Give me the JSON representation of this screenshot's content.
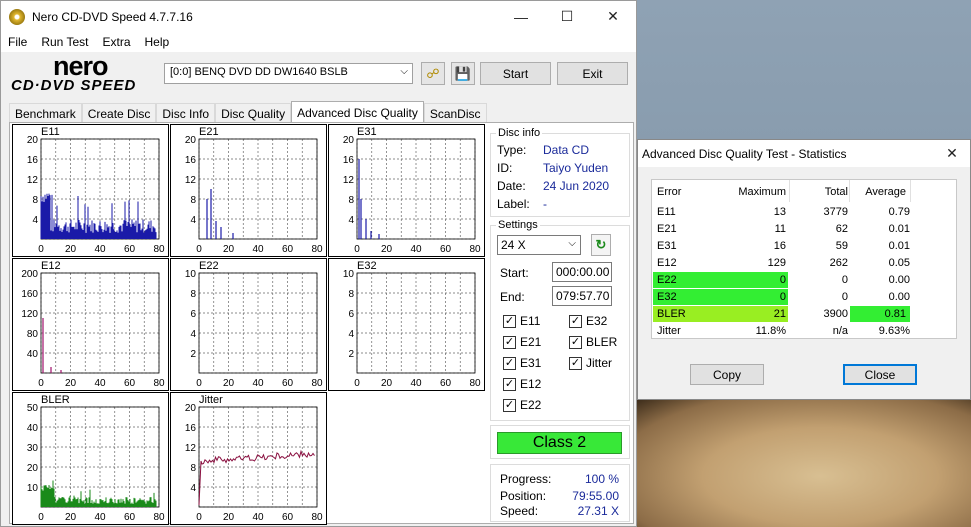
{
  "app": {
    "title": "Nero CD-DVD Speed 4.7.7.16",
    "menu": [
      "File",
      "Run Test",
      "Extra",
      "Help"
    ],
    "logo_word": "nero",
    "logo_sub": "CD·DVD SPEED",
    "drive": "[0:0]   BENQ DVD DD DW1640 BSLB",
    "start_label": "Start",
    "exit_label": "Exit",
    "tabs": [
      "Benchmark",
      "Create Disc",
      "Disc Info",
      "Disc Quality",
      "Advanced Disc Quality",
      "ScanDisc"
    ],
    "active_tab": "Advanced Disc Quality"
  },
  "disc_info": {
    "label": "Disc info",
    "type_key": "Type:",
    "type": "Data CD",
    "id_key": "ID:",
    "id": "Taiyo Yuden",
    "date_key": "Date:",
    "date": "24 Jun 2020",
    "label_key": "Label:",
    "label_val": "-"
  },
  "settings": {
    "label": "Settings",
    "speed": "24 X",
    "start_key": "Start:",
    "start": "000:00.00",
    "end_key": "End:",
    "end": "079:57.70",
    "checkboxes": [
      {
        "label": "E11",
        "checked": true
      },
      {
        "label": "E32",
        "checked": true
      },
      {
        "label": "E21",
        "checked": true
      },
      {
        "label": "BLER",
        "checked": true
      },
      {
        "label": "E31",
        "checked": true
      },
      {
        "label": "Jitter",
        "checked": true
      },
      {
        "label": "E12",
        "checked": true
      },
      {
        "label": "E22",
        "checked": true
      }
    ]
  },
  "class_label": "Class 2",
  "progress": {
    "progress_key": "Progress:",
    "progress": "100 %",
    "position_key": "Position:",
    "position": "79:55.00",
    "speed_key": "Speed:",
    "speed": "27.31 X"
  },
  "graphs": [
    {
      "name": "E11",
      "yticks": [
        "20",
        "16",
        "12",
        "8",
        "4"
      ],
      "xticks": [
        "0",
        "20",
        "40",
        "60",
        "80"
      ],
      "color": "#1a1aa8"
    },
    {
      "name": "E21",
      "yticks": [
        "20",
        "16",
        "12",
        "8",
        "4"
      ],
      "xticks": [
        "0",
        "20",
        "40",
        "60",
        "80"
      ],
      "color": "#1a1aa8"
    },
    {
      "name": "E31",
      "yticks": [
        "20",
        "16",
        "12",
        "8",
        "4"
      ],
      "xticks": [
        "0",
        "20",
        "40",
        "60",
        "80"
      ],
      "color": "#1a1aa8"
    },
    {
      "name": "E12",
      "yticks": [
        "200",
        "160",
        "120",
        "80",
        "40"
      ],
      "xticks": [
        "0",
        "20",
        "40",
        "60",
        "80"
      ],
      "color": "#a0106a"
    },
    {
      "name": "E22",
      "yticks": [
        "10",
        "8",
        "6",
        "4",
        "2"
      ],
      "xticks": [
        "0",
        "20",
        "40",
        "60",
        "80"
      ],
      "color": "#1a1aa8"
    },
    {
      "name": "E32",
      "yticks": [
        "10",
        "8",
        "6",
        "4",
        "2"
      ],
      "xticks": [
        "0",
        "20",
        "40",
        "60",
        "80"
      ],
      "color": "#1a1aa8"
    },
    {
      "name": "BLER",
      "yticks": [
        "50",
        "40",
        "30",
        "20",
        "10"
      ],
      "xticks": [
        "0",
        "20",
        "40",
        "60",
        "80"
      ],
      "color": "#1a8a1a"
    },
    {
      "name": "Jitter",
      "yticks": [
        "20",
        "16",
        "12",
        "8",
        "4"
      ],
      "xticks": [
        "0",
        "20",
        "40",
        "60",
        "80"
      ],
      "color": "#8a1040"
    }
  ],
  "stats": {
    "title": "Advanced Disc Quality Test - Statistics",
    "headers": [
      "Error",
      "Maximum",
      "Total",
      "Average"
    ],
    "rows": [
      {
        "error": "E11",
        "maximum": "13",
        "total": "3779",
        "average": "0.79",
        "hl_max": "",
        "hl_avg": ""
      },
      {
        "error": "E21",
        "maximum": "11",
        "total": "62",
        "average": "0.01",
        "hl_max": "",
        "hl_avg": ""
      },
      {
        "error": "E31",
        "maximum": "16",
        "total": "59",
        "average": "0.01",
        "hl_max": "",
        "hl_avg": ""
      },
      {
        "error": "E12",
        "maximum": "129",
        "total": "262",
        "average": "0.05",
        "hl_max": "",
        "hl_avg": ""
      },
      {
        "error": "E22",
        "maximum": "0",
        "total": "0",
        "average": "0.00",
        "hl_max": "#33ee33",
        "hl_avg": ""
      },
      {
        "error": "E32",
        "maximum": "0",
        "total": "0",
        "average": "0.00",
        "hl_max": "#33ee33",
        "hl_avg": ""
      },
      {
        "error": "BLER",
        "maximum": "21",
        "total": "3900",
        "average": "0.81",
        "hl_max": "#99ee22",
        "hl_avg": "#33ee33"
      },
      {
        "error": "Jitter",
        "maximum": "11.8%",
        "total": "n/a",
        "average": "9.63%",
        "hl_max": "",
        "hl_avg": ""
      }
    ],
    "copy_label": "Copy",
    "close_label": "Close"
  }
}
